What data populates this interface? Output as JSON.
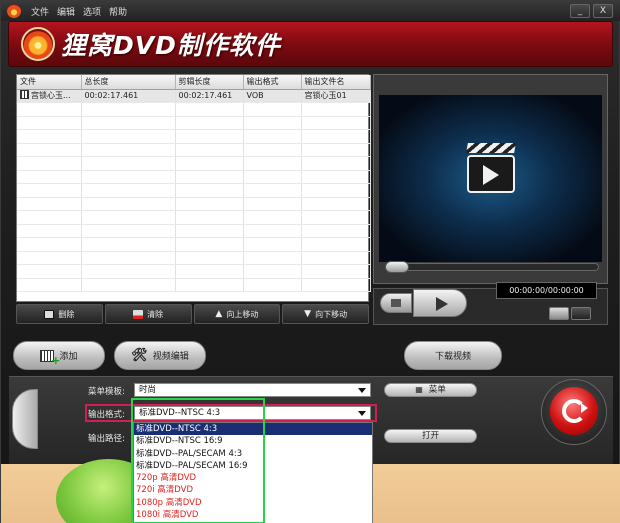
{
  "menubar": {
    "items": [
      "文件",
      "编辑",
      "选项",
      "帮助"
    ],
    "min_label": "_",
    "close_label": "X"
  },
  "banner": {
    "title": "狸窝DVD制作软件"
  },
  "file_table": {
    "columns": [
      "文件",
      "总长度",
      "剪辑长度",
      "输出格式",
      "输出文件名"
    ],
    "rows": [
      [
        "宫锁心玉...",
        "00:02:17.461",
        "00:02:17.461",
        "VOB",
        "宫锁心玉01"
      ]
    ]
  },
  "list_buttons": {
    "delete": "删除",
    "clear": "清除",
    "move_up": "向上移动",
    "move_down": "向下移动"
  },
  "player": {
    "time": "00:00:00/00:00:00",
    "seek_position": 0
  },
  "actions": {
    "add": "添加",
    "video_edit": "视频编辑",
    "download_video": "下载视频"
  },
  "settings": {
    "menu_template_label": "菜单模板:",
    "menu_template_value": "时尚",
    "menu_button": "菜单",
    "output_format_label": "输出格式:",
    "output_format_value": "标准DVD--NTSC 4:3",
    "output_path_label": "输出路径:",
    "open_button": "打开"
  },
  "format_options": [
    "标准DVD--NTSC 4:3",
    "标准DVD--NTSC 16:9",
    "标准DVD--PAL/SECAM 4:3",
    "标准DVD--PAL/SECAM 16:9",
    "720p 高清DVD",
    "720i 高清DVD",
    "1080p 高清DVD",
    "1080i 高清DVD"
  ],
  "colors": {
    "banner_red": "#9e0f17",
    "selection_blue": "#1a2f73",
    "hd_option_red": "#e0221c",
    "highlight_pink": "#d01f52",
    "highlight_green": "#29d24a"
  }
}
